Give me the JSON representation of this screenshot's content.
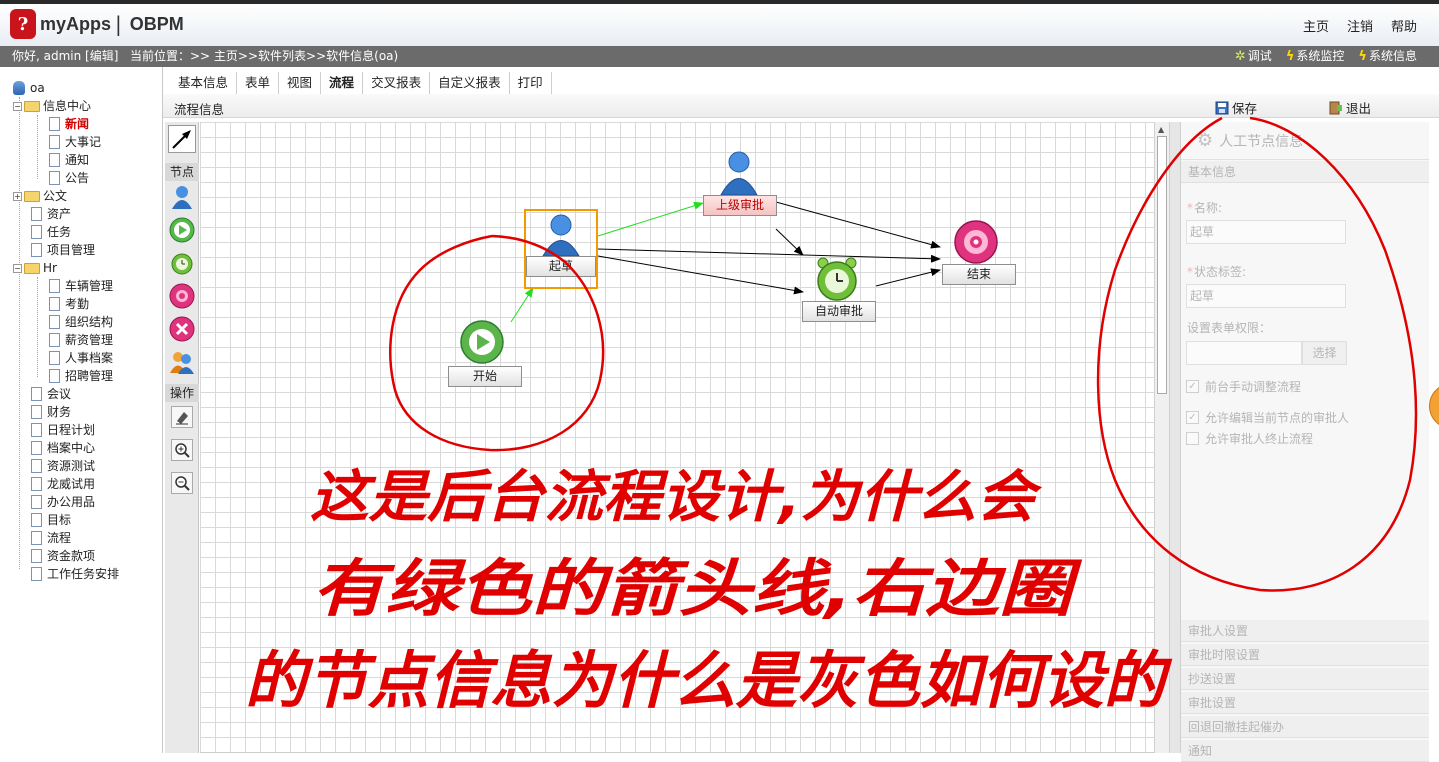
{
  "app": {
    "logo_mark": "?",
    "name": "myApps",
    "product": "OBPM"
  },
  "top_links": [
    "主页",
    "注销",
    "帮助"
  ],
  "infobar": {
    "greeting": "你好, admin [编辑]",
    "breadcrumb": "当前位置：>> 主页>>软件列表>>软件信息(oa)",
    "tools": [
      "调试",
      "系统监控",
      "系统信息"
    ]
  },
  "sidebar": {
    "root": "oa",
    "items": [
      {
        "label": "信息中心",
        "type": "folder"
      },
      {
        "label": "新闻",
        "type": "doc",
        "active": true
      },
      {
        "label": "大事记",
        "type": "doc"
      },
      {
        "label": "通知",
        "type": "doc"
      },
      {
        "label": "公告",
        "type": "doc"
      },
      {
        "label": "公文",
        "type": "folder"
      },
      {
        "label": "资产",
        "type": "doc"
      },
      {
        "label": "任务",
        "type": "doc"
      },
      {
        "label": "项目管理",
        "type": "doc"
      },
      {
        "label": "Hr",
        "type": "folder"
      },
      {
        "label": "车辆管理",
        "type": "doc"
      },
      {
        "label": "考勤",
        "type": "doc"
      },
      {
        "label": "组织结构",
        "type": "doc"
      },
      {
        "label": "薪资管理",
        "type": "doc"
      },
      {
        "label": "人事档案",
        "type": "doc"
      },
      {
        "label": "招聘管理",
        "type": "doc"
      },
      {
        "label": "会议",
        "type": "doc"
      },
      {
        "label": "财务",
        "type": "doc"
      },
      {
        "label": "日程计划",
        "type": "doc"
      },
      {
        "label": "档案中心",
        "type": "doc"
      },
      {
        "label": "资源测试",
        "type": "doc"
      },
      {
        "label": "龙威试用",
        "type": "doc"
      },
      {
        "label": "办公用品",
        "type": "doc"
      },
      {
        "label": "目标",
        "type": "doc"
      },
      {
        "label": "流程",
        "type": "doc"
      },
      {
        "label": "资金款项",
        "type": "doc"
      },
      {
        "label": "工作任务安排",
        "type": "doc"
      }
    ]
  },
  "tabs": [
    {
      "label": "基本信息"
    },
    {
      "label": "表单"
    },
    {
      "label": "视图"
    },
    {
      "label": "流程",
      "active": true
    },
    {
      "label": "交叉报表"
    },
    {
      "label": "自定义报表"
    },
    {
      "label": "打印"
    }
  ],
  "subheader": {
    "title": "流程信息",
    "save": "保存",
    "exit": "退出"
  },
  "palette": {
    "nodes_label": "节点",
    "ops_label": "操作"
  },
  "flow": {
    "nodes": [
      {
        "id": "start",
        "label": "开始"
      },
      {
        "id": "draft",
        "label": "起草"
      },
      {
        "id": "superior",
        "label": "上级审批"
      },
      {
        "id": "auto",
        "label": "自动审批"
      },
      {
        "id": "end",
        "label": "结束"
      }
    ]
  },
  "right_panel": {
    "title": "人工节点信息",
    "basic_section": "基本信息",
    "name_label": "名称:",
    "name_value": "起草",
    "status_label": "状态标签:",
    "status_value": "起草",
    "form_perm_label": "设置表单权限：",
    "choose_button": "选择",
    "checks": [
      {
        "label": "前台手动调整流程",
        "checked": true
      },
      {
        "label": "允许编辑当前节点的审批人",
        "checked": true
      },
      {
        "label": "允许审批人终止流程",
        "checked": false
      }
    ],
    "sections": [
      "审批人设置",
      "审批时限设置",
      "抄送设置",
      "审批设置",
      "回退回撤挂起催办",
      "通知"
    ]
  },
  "annotation": {
    "line1": "这是后台流程设计,为什么会",
    "line2": "有绿色的箭头线,右边圈",
    "line3": "的节点信息为什么是灰色如何设的"
  },
  "colors": {
    "annotation": "#e00000",
    "green_arrow": "#22dd22",
    "selection": "#f29a00"
  }
}
